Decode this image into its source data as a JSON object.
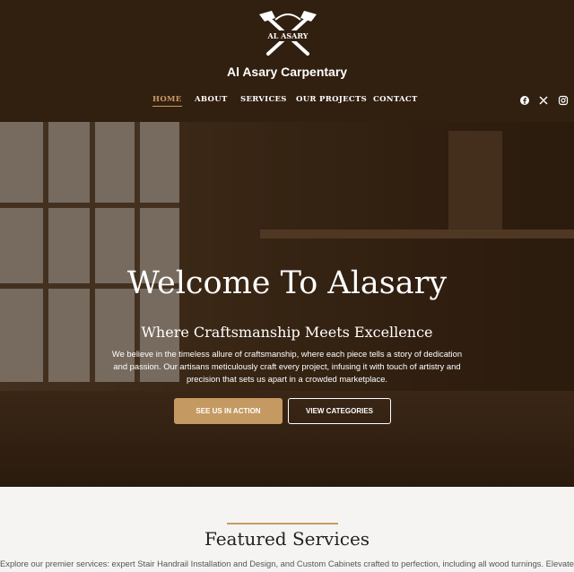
{
  "header": {
    "logo_text": "AL ASARY",
    "site_title": "Al Asary Carpentary"
  },
  "nav": {
    "items": [
      {
        "label": "HOME",
        "active": true
      },
      {
        "label": "ABOUT",
        "active": false
      },
      {
        "label": "SERVICES",
        "active": false
      },
      {
        "label": "OUR PROJECTS",
        "active": false
      },
      {
        "label": "CONTACT",
        "active": false
      }
    ],
    "social": [
      "facebook-icon",
      "x-icon",
      "instagram-icon"
    ]
  },
  "hero": {
    "title": "Welcome To Alasary",
    "subtitle": "Where Craftsmanship Meets Excellence",
    "description": "We believe in the timeless allure of craftsmanship, where each piece tells a story of dedication and passion. Our artisans meticulously craft every project, infusing it with touch of artistry and precision that sets us apart in a crowded marketplace.",
    "primary_button": "SEE US IN ACTION",
    "secondary_button": "VIEW CATEGORIES"
  },
  "featured": {
    "title": "Featured Services",
    "description": "Explore our premier services: expert Stair Handrail Installation and Design, and Custom Cabinets crafted to perfection, including all wood turnings. Elevate"
  },
  "colors": {
    "header_bg": "#311f0f",
    "accent": "#c89b63",
    "button_primary": "#c49a62"
  }
}
